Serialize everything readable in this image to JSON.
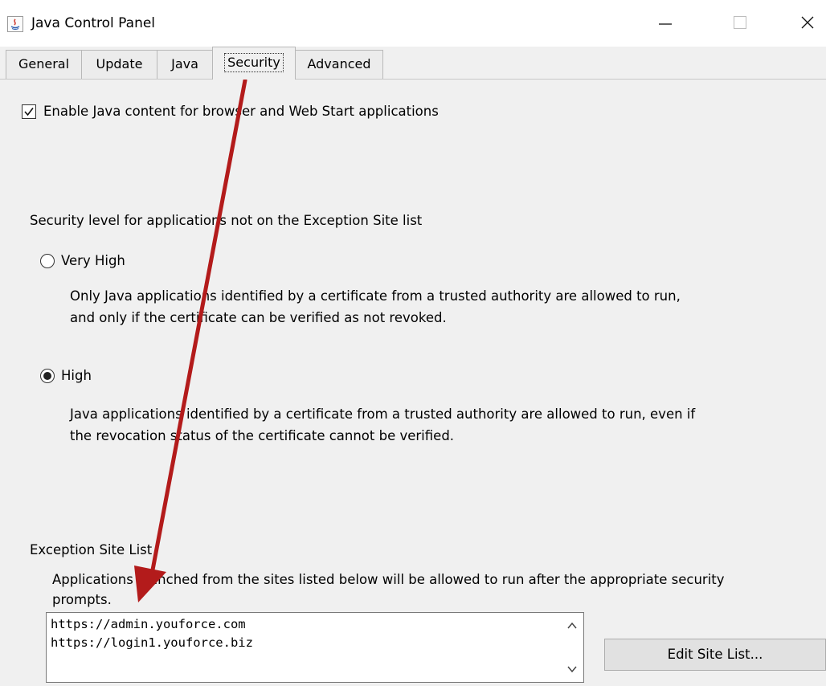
{
  "window": {
    "title": "Java Control Panel",
    "icon": "java-icon",
    "controls": [
      "minimize-icon",
      "maximize-icon",
      "close-icon"
    ]
  },
  "tabs": [
    {
      "label": "General",
      "active": false
    },
    {
      "label": "Update",
      "active": false
    },
    {
      "label": "Java",
      "active": false
    },
    {
      "label": "Security",
      "active": true
    },
    {
      "label": "Advanced",
      "active": false
    }
  ],
  "security": {
    "enable_java": {
      "label": "Enable Java content for browser and Web Start applications",
      "checked": true
    },
    "level_heading": "Security level for applications not on the Exception Site list",
    "levels": [
      {
        "label": "Very High",
        "selected": false,
        "description_line1": "Only Java applications identified by a certificate from a trusted authority are allowed to run,",
        "description_line2": "and only if the certificate can be verified as not revoked."
      },
      {
        "label": "High",
        "selected": true,
        "description_line1": "Java applications identified by a certificate from a trusted authority are allowed to run, even if",
        "description_line2": "the revocation status of the certificate cannot be verified."
      }
    ],
    "exception": {
      "heading": "Exception Site List",
      "description_line1": "Applications launched from the sites listed below will be allowed to run after the appropriate security",
      "description_line2": "prompts.",
      "sites": [
        "https://admin.youforce.com",
        "https://login1.youforce.biz"
      ],
      "edit_button_label": "Edit Site List..."
    }
  },
  "annotation": {
    "arrow_color": "#b31b1b"
  }
}
